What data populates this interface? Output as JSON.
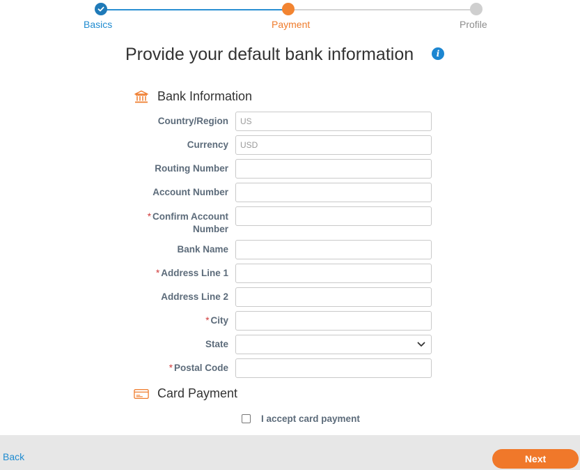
{
  "stepper": {
    "steps": [
      {
        "label": "Basics",
        "state": "complete"
      },
      {
        "label": "Payment",
        "state": "current"
      },
      {
        "label": "Profile",
        "state": "upcoming"
      }
    ]
  },
  "page_title": "Provide your default bank information",
  "bank_section": {
    "title": "Bank Information",
    "icon": "bank-icon",
    "fields": [
      {
        "label": "Country/Region",
        "required": false,
        "placeholder": "US",
        "value": ""
      },
      {
        "label": "Currency",
        "required": false,
        "placeholder": "USD",
        "value": ""
      },
      {
        "label": "Routing Number",
        "required": false,
        "placeholder": "",
        "value": ""
      },
      {
        "label": "Account Number",
        "required": false,
        "placeholder": "",
        "value": ""
      },
      {
        "label": "Confirm Account Number",
        "required": true,
        "placeholder": "",
        "value": ""
      },
      {
        "label": "Bank Name",
        "required": false,
        "placeholder": "",
        "value": ""
      },
      {
        "label": "Address Line 1",
        "required": true,
        "placeholder": "",
        "value": ""
      },
      {
        "label": "Address Line 2",
        "required": false,
        "placeholder": "",
        "value": ""
      },
      {
        "label": "City",
        "required": true,
        "placeholder": "",
        "value": ""
      },
      {
        "label": "State",
        "required": false,
        "type": "select",
        "value": ""
      },
      {
        "label": "Postal Code",
        "required": true,
        "placeholder": "",
        "value": ""
      }
    ]
  },
  "card_section": {
    "title": "Card Payment",
    "icon": "credit-card-icon",
    "checkbox_label": "I accept card payment",
    "checked": false
  },
  "footer": {
    "back_label": "Back",
    "next_label": "Next"
  },
  "colors": {
    "accent_orange": "#f0782a",
    "link_blue": "#1f8bd0",
    "required_red": "#d03a3a"
  }
}
